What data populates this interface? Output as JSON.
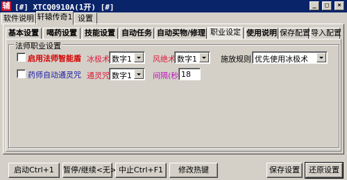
{
  "window": {
    "icon_glyph": "辅",
    "title": "[#] XTCQ0910A(1开) [#]",
    "controls": [
      "_",
      "□",
      "×"
    ]
  },
  "top_tabs": [
    "软件说明",
    "轩辕传奇1",
    "设置"
  ],
  "sub_tabs": [
    "基本设置",
    "喝药设置",
    "技能设置",
    "自动任务",
    "自动买物/修理",
    "职业设定",
    "使用说明",
    "保存配置",
    "导入配置"
  ],
  "group": {
    "title": "法师职业设置",
    "row1": {
      "checkbox_label": "启用法师智能盾",
      "field1_label": "冰极术",
      "field1_value": "数字1",
      "field2_label": "风绝术",
      "field2_value": "数字1",
      "rule_label": "施放规则",
      "rule_value": "优先使用冰极术"
    },
    "row2": {
      "checkbox_label": "药师自动通灵咒",
      "field1_label": "通灵咒",
      "field1_value": "数字1",
      "interval_label": "间隔(秒)",
      "interval_value": "18"
    }
  },
  "bottom_buttons": {
    "start": "启动Ctrl+1",
    "pause": "暂停/继续<无>",
    "stop": "中止Ctrl+F1",
    "hotkey": "修改热键",
    "save": "保存设置",
    "restore": "还原设置"
  },
  "colors": {
    "title_bg": "#0a246a",
    "face": "#d4d0c8",
    "red_label": "#d40000",
    "blue_label": "#1a1aa8",
    "pink_label": "#e0183c",
    "magenta_label": "#c010c0"
  }
}
